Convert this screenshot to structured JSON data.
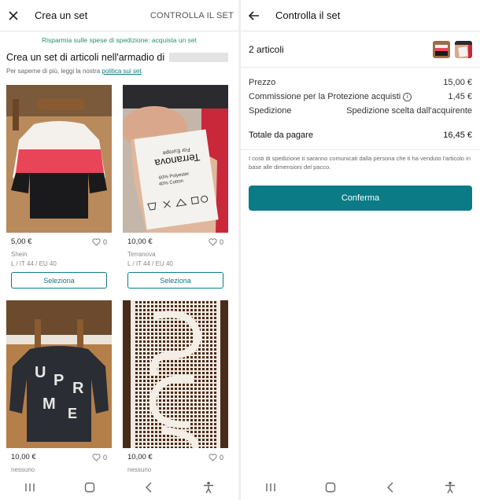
{
  "left": {
    "header": {
      "title": "Crea un set",
      "action": "CONTROLLA IL SET"
    },
    "promo": "Risparmia sulle spese di spedizione: acquista un set",
    "heading": "Crea un set di articoli nell'armadio di",
    "policy": {
      "text": "Per saperne di più, leggi la nostra ",
      "link": "politica sui set",
      "suffix": "."
    },
    "items": [
      {
        "price": "5,00 €",
        "likes": "0",
        "brand": "Shein",
        "size": "L / IT 44 / EU 40",
        "button": "Seleziona"
      },
      {
        "price": "10,00 €",
        "likes": "0",
        "brand": "Terranova",
        "size": "L / IT 44 / EU 40",
        "button": "Seleziona"
      },
      {
        "price": "10,00 €",
        "likes": "0",
        "brand": "nessuno",
        "size": "",
        "button": ""
      },
      {
        "price": "10,00 €",
        "likes": "0",
        "brand": "nessuno",
        "size": "",
        "button": ""
      }
    ],
    "label_text": {
      "line1": "For Europe",
      "line2": "Terranova",
      "line3": "60% Polyester",
      "line4": "40% Cotton"
    }
  },
  "right": {
    "header": {
      "title": "Controlla il set"
    },
    "summary": {
      "count": "2 articoli"
    },
    "costs": [
      {
        "label": "Prezzo",
        "value": "15,00 €"
      },
      {
        "label": "Commissione per la Protezione acquisti",
        "value": "1,45 €",
        "info": "i"
      },
      {
        "label": "Spedizione",
        "value": "Spedizione scelta dall'acquirente"
      }
    ],
    "total": {
      "label": "Totale da pagare",
      "value": "16,45 €"
    },
    "note": "I costi di spedizione ti saranno comunicati dalla persona che ti ha venduto l'articolo in base alle dimensioni del pacco.",
    "confirm": "Conferma"
  },
  "sweater_letters": [
    "U",
    "P",
    "R",
    "M",
    "E"
  ],
  "icons": [
    "close-icon",
    "back-arrow-icon",
    "heart-icon",
    "info-icon",
    "recents-icon",
    "home-icon",
    "nav-back-icon",
    "accessibility-icon"
  ],
  "colors": {
    "accent": "#0b7b85",
    "promo": "#2a8f72"
  }
}
